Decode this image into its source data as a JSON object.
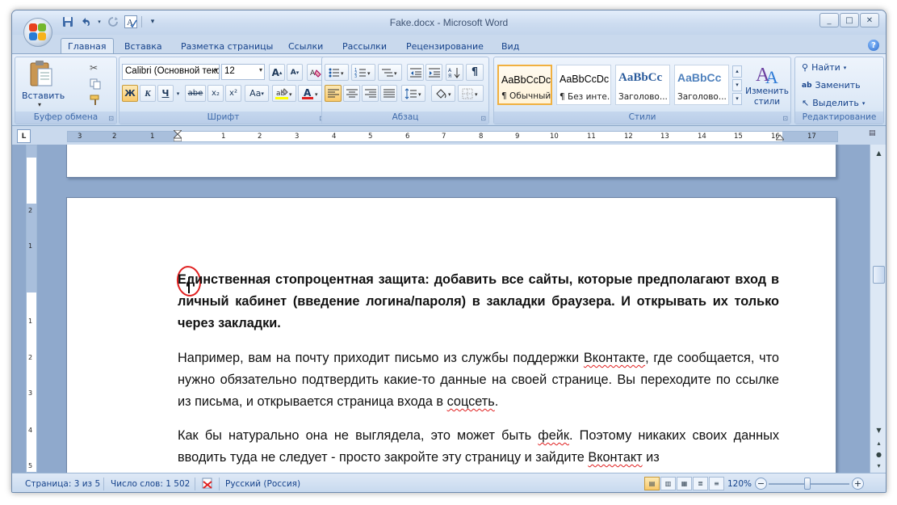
{
  "window": {
    "title": "Fake.docx - Microsoft Word",
    "controls": [
      "_",
      "□",
      "✕"
    ]
  },
  "quick_access": {
    "icons": [
      "save-icon",
      "undo-icon",
      "redo-icon",
      "spellcheck-icon",
      "customize-icon"
    ]
  },
  "tabs": [
    {
      "label": "Главная",
      "active": true
    },
    {
      "label": "Вставка"
    },
    {
      "label": "Разметка страницы"
    },
    {
      "label": "Ссылки"
    },
    {
      "label": "Рассылки"
    },
    {
      "label": "Рецензирование"
    },
    {
      "label": "Вид"
    }
  ],
  "ribbon": {
    "clipboard": {
      "label": "Буфер обмена",
      "paste_label": "Вставить"
    },
    "font": {
      "label": "Шрифт",
      "font_name": "Calibri (Основной текст)",
      "font_size": "12",
      "bold": "Ж",
      "italic": "К",
      "underline": "Ч",
      "strike": "abe",
      "subscript": "x₂",
      "superscript": "x²",
      "change_case": "Aa",
      "grow": "A",
      "shrink": "A"
    },
    "paragraph": {
      "label": "Абзац"
    },
    "styles": {
      "label": "Стили",
      "items": [
        {
          "sample": "AaBbCcDc",
          "name": "¶ Обычный",
          "selected": true
        },
        {
          "sample": "AaBbCcDc",
          "name": "¶ Без инте..."
        },
        {
          "sample": "AaBbCc",
          "name": "Заголово..."
        },
        {
          "sample": "AaBbCc",
          "name": "Заголово..."
        }
      ],
      "change_styles_label": "Изменить стили"
    },
    "editing": {
      "label": "Редактирование",
      "find": "Найти",
      "replace": "Заменить",
      "select": "Выделить"
    }
  },
  "ruler": {
    "left_numbers": [
      "3",
      "2",
      "1"
    ],
    "right_numbers": [
      "1",
      "2",
      "3",
      "4",
      "5",
      "6",
      "7",
      "8",
      "9",
      "10",
      "11",
      "12",
      "13",
      "14",
      "15",
      "16",
      "17"
    ]
  },
  "vruler": {
    "numbers": [
      "2",
      "1",
      "1",
      "2",
      "3",
      "4",
      "5"
    ]
  },
  "document": {
    "p1": "Единственная стопроцентная защита: добавить все сайты, которые предполагают вход в личный кабинет (введение логина/пароля) в закладки браузера. И открывать их только через закладки.",
    "p2_a": "Например, вам на почту приходит письмо из службы поддержки ",
    "p2_vk": "Вконтакте",
    "p2_b": ", где сообщается, что нужно обязательно подтвердить какие-то данные на своей странице. Вы переходите по ссылке из письма, и открывается страница входа в ",
    "p2_soc": "соцсеть",
    "p2_c": ".",
    "p3_a": "Как бы натурально она не выглядела, это может быть ",
    "p3_fake": "фейк",
    "p3_b": ". Поэтому никаких своих данных вводить туда не следует - просто закройте эту страницу и зайдите ",
    "p3_vk": "Вконтакт",
    "p3_c": " из"
  },
  "status": {
    "page": "Страница: 3 из 5",
    "words": "Число слов: 1 502",
    "language": "Русский (Россия)",
    "zoom": "120%",
    "zoom_minus": "−",
    "zoom_plus": "+"
  },
  "colors": {
    "annotation_red": "#e02020",
    "highlight": "#ffff00",
    "font_color": "#e02020"
  }
}
